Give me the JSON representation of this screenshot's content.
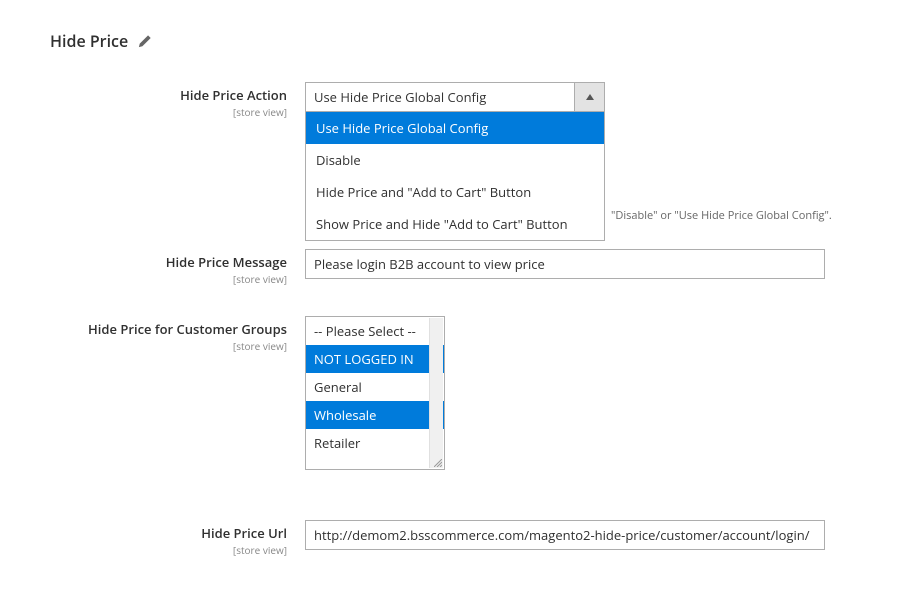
{
  "section": {
    "title": "Hide Price"
  },
  "fields": {
    "action": {
      "label": "Hide Price Action",
      "scope": "[store view]",
      "value": "Use Hide Price Global Config",
      "options": [
        "Use Hide Price Global Config",
        "Disable",
        "Hide Price and \"Add to Cart\" Button",
        "Show Price and Hide \"Add to Cart\" Button"
      ],
      "help": "\"Disable\" or \"Use Hide Price Global Config\"."
    },
    "message": {
      "label": "Hide Price Message",
      "scope": "[store view]",
      "value": "Please login B2B account to view price"
    },
    "groups": {
      "label": "Hide Price for Customer Groups",
      "scope": "[store view]",
      "options": [
        {
          "label": "-- Please Select --",
          "selected": false
        },
        {
          "label": "NOT LOGGED IN",
          "selected": true
        },
        {
          "label": "General",
          "selected": false
        },
        {
          "label": "Wholesale",
          "selected": true
        },
        {
          "label": "Retailer",
          "selected": false
        }
      ]
    },
    "url": {
      "label": "Hide Price Url",
      "scope": "[store view]",
      "value": "http://demom2.bsscommerce.com/magento2-hide-price/customer/account/login/"
    }
  }
}
